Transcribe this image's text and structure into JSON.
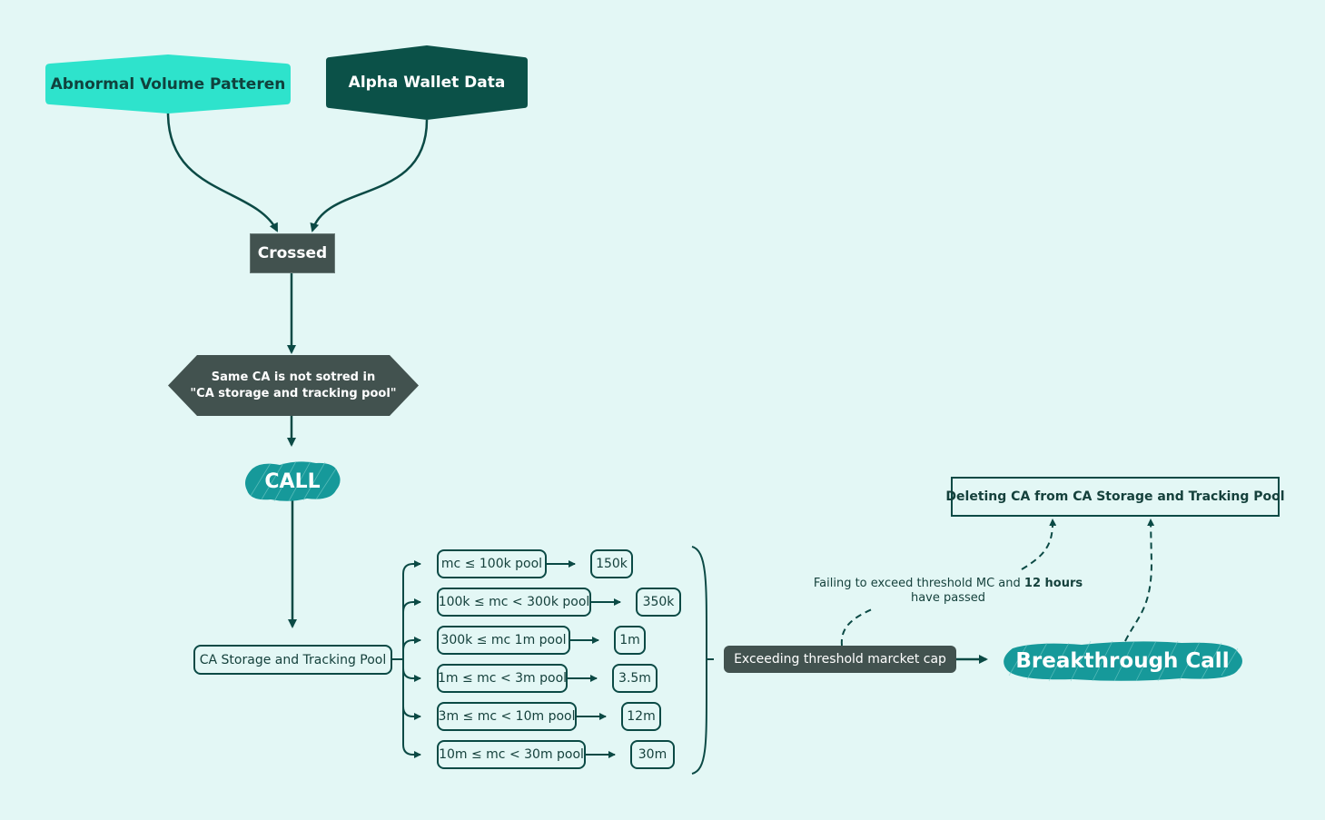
{
  "nodes": {
    "abnormal_volume": "Abnormal Volume Patteren",
    "alpha_wallet": "Alpha Wallet Data",
    "crossed": "Crossed",
    "condition_line1": "Same CA is not sotred in",
    "condition_line2": "\"CA storage and tracking pool\"",
    "call": "CALL",
    "storage_pool": "CA Storage and Tracking Pool",
    "exceeding": "Exceeding threshold marcket cap",
    "breakthrough": "Breakthrough Call",
    "deleting": "Deleting CA from CA Storage and Tracking Pool"
  },
  "failing_note": {
    "prefix": "Failing to exceed threshold MC and ",
    "bold": "12 hours",
    "line2": "have passed"
  },
  "pools": [
    {
      "range": "mc ≤ 100k pool",
      "threshold": "150k"
    },
    {
      "range": "100k ≤ mc < 300k pool",
      "threshold": "350k"
    },
    {
      "range": "300k ≤ mc 1m pool",
      "threshold": "1m"
    },
    {
      "range": "1m ≤ mc < 3m pool",
      "threshold": "3.5m"
    },
    {
      "range": "3m ≤ mc < 10m pool",
      "threshold": "12m"
    },
    {
      "range": "10m ≤ mc < 30m pool",
      "threshold": "30m"
    }
  ],
  "colors": {
    "background": "#e3f7f5",
    "mint": "#2ee3cc",
    "dark_green": "#0b5148",
    "slate": "#42524f",
    "teal": "#16999a",
    "line": "#0b4a45"
  }
}
